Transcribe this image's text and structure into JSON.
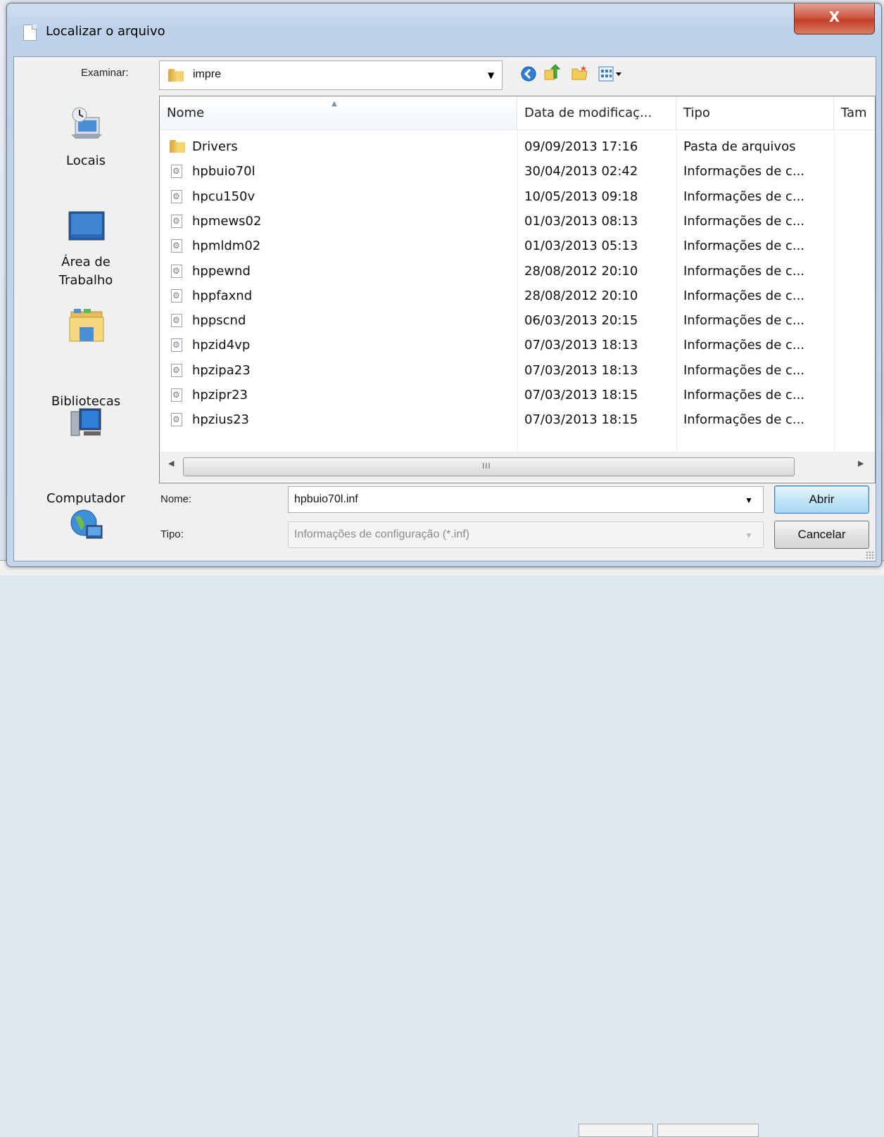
{
  "dialog": {
    "title": "Localizar o arquivo",
    "close_glyph": "X"
  },
  "lookin": {
    "label": "Examinar:",
    "value": "impre",
    "icon": "folder-icon"
  },
  "toolbar": {
    "icons": [
      "back-icon",
      "up-folder-icon",
      "new-folder-icon",
      "view-menu-icon"
    ]
  },
  "places": [
    {
      "label": "Locais",
      "icon": "recent-places-icon"
    },
    {
      "label": "Área de\nTrabalho",
      "icon": "desktop-icon"
    },
    {
      "label": "Bibliotecas",
      "icon": "libraries-icon"
    },
    {
      "label": "Computador",
      "icon": "computer-icon"
    },
    {
      "label": "",
      "icon": "network-icon"
    }
  ],
  "list": {
    "columns": [
      "Nome",
      "Data de modificaç...",
      "Tipo",
      "Tam"
    ],
    "sorted_column": "Nome",
    "scroll_grip": "III",
    "rows": [
      {
        "name": "Drivers",
        "date": "09/09/2013 17:16",
        "type": "Pasta de arquivos",
        "kind": "folder"
      },
      {
        "name": "hpbuio70l",
        "date": "30/04/2013 02:42",
        "type": "Informações de c...",
        "kind": "file"
      },
      {
        "name": "hpcu150v",
        "date": "10/05/2013 09:18",
        "type": "Informações de c...",
        "kind": "file"
      },
      {
        "name": "hpmews02",
        "date": "01/03/2013 08:13",
        "type": "Informações de c...",
        "kind": "file"
      },
      {
        "name": "hpmldm02",
        "date": "01/03/2013 05:13",
        "type": "Informações de c...",
        "kind": "file"
      },
      {
        "name": "hppewnd",
        "date": "28/08/2012 20:10",
        "type": "Informações de c...",
        "kind": "file"
      },
      {
        "name": "hppfaxnd",
        "date": "28/08/2012 20:10",
        "type": "Informações de c...",
        "kind": "file"
      },
      {
        "name": "hppscnd",
        "date": "06/03/2013 20:15",
        "type": "Informações de c...",
        "kind": "file"
      },
      {
        "name": "hpzid4vp",
        "date": "07/03/2013 18:13",
        "type": "Informações de c...",
        "kind": "file"
      },
      {
        "name": "hpzipa23",
        "date": "07/03/2013 18:13",
        "type": "Informações de c...",
        "kind": "file"
      },
      {
        "name": "hpzipr23",
        "date": "07/03/2013 18:15",
        "type": "Informações de c...",
        "kind": "file"
      },
      {
        "name": "hpzius23",
        "date": "07/03/2013 18:15",
        "type": "Informações de c...",
        "kind": "file"
      }
    ]
  },
  "filename": {
    "label": "Nome:",
    "value": "hpbuio70l.inf"
  },
  "filetype": {
    "label": "Tipo:",
    "value": "Informações de configuração (*.inf)"
  },
  "buttons": {
    "open": "Abrir",
    "cancel": "Cancelar"
  },
  "colors": {
    "title_gradient": "#bcd1ea",
    "close_red": "#c33f25",
    "default_button": "#a7d9f5"
  }
}
